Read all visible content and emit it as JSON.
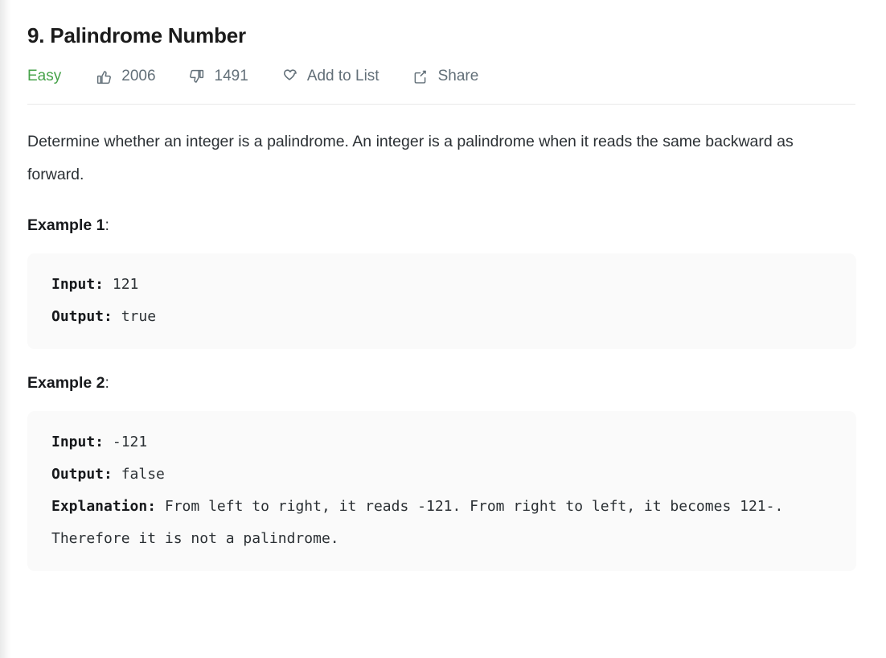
{
  "problem": {
    "title": "9. Palindrome Number",
    "difficulty": "Easy",
    "difficulty_color": "#46a24a",
    "likes": "2006",
    "dislikes": "1491",
    "add_to_list_label": "Add to List",
    "share_label": "Share",
    "description": "Determine whether an integer is a palindrome. An integer is a palindrome when it reads the same backward as forward."
  },
  "examples": [
    {
      "heading": "Example 1",
      "heading_colon": ":",
      "lines": [
        {
          "key": "Input:",
          "value": " 121"
        },
        {
          "key": "Output:",
          "value": " true"
        }
      ]
    },
    {
      "heading": "Example 2",
      "heading_colon": ":",
      "lines": [
        {
          "key": "Input:",
          "value": " -121"
        },
        {
          "key": "Output:",
          "value": " false"
        },
        {
          "key": "Explanation:",
          "value": " From left to right, it reads -121. From right to left, it becomes 121-. Therefore it is not a palindrome."
        }
      ]
    }
  ]
}
